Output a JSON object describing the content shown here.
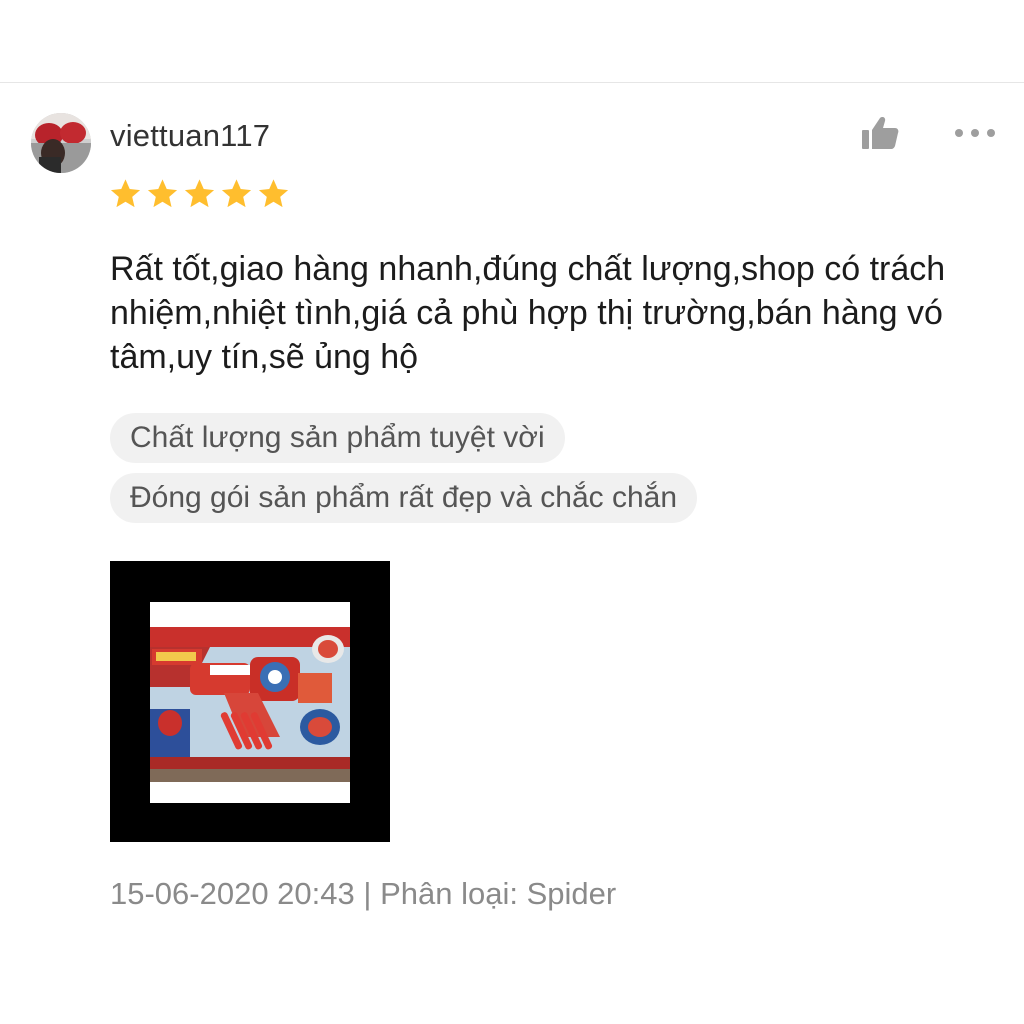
{
  "review": {
    "username": "viettuan117",
    "rating": 5,
    "rating_max": 5,
    "text": "Rất tốt,giao hàng nhanh,đúng chất lượng,shop có trách nhiệm,nhiệt tình,giá cả phù hợp thị trường,bán hàng vó tâm,uy tín,sẽ ủng hộ",
    "tags": [
      "Chất lượng sản phẩm tuyệt vời",
      "Đóng gói sản phẩm rất đẹp và chắc chắn"
    ],
    "date": "15-06-2020 20:43",
    "separator": "|",
    "variation": "Phân loại: Spider"
  },
  "icons": {
    "like": "thumbs-up-icon",
    "more": "more-options-icon",
    "star": "star-icon"
  },
  "colors": {
    "star": "#ffbe2e",
    "text": "#1c1c1c",
    "muted": "#8a8a8a",
    "tag_bg": "#f1f1f1",
    "icon": "#9e9e9e"
  }
}
